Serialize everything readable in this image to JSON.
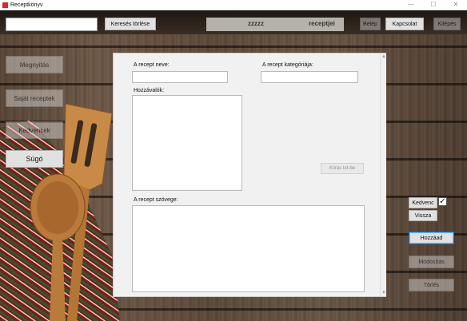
{
  "window": {
    "title": "Receptkönyv",
    "min_glyph": "—",
    "max_glyph": "☐",
    "close_glyph": "✕"
  },
  "top": {
    "search_value": "",
    "clear_search_label": "Keresés törlése",
    "info_left": "zzzzz",
    "info_right": "receptjei",
    "login_label": "Belép",
    "contact_label": "Kapcsolat",
    "logout_label": "Kilépés"
  },
  "sidebar": {
    "open_label": "Megnyitás",
    "own_recipes_label": "Saját receptek",
    "favorites_label": "Kedvencek",
    "help_label": "Súgó"
  },
  "form": {
    "name_label": "A recept neve:",
    "name_value": "",
    "category_label": "A recept kategóriája:",
    "category_value": "",
    "ingredients_label": "Hozzávalók:",
    "ingredients_value": "",
    "export_label": "Kiírás txt-be",
    "text_label": "A recept szövege:",
    "text_value": ""
  },
  "right": {
    "favorite_label": "Kedvenc",
    "favorite_checked": true,
    "favorite_mark": "✓",
    "back_label": "Vissza",
    "add_label": "Hozzáad",
    "modify_label": "Módosítás",
    "delete_label": "Törlés"
  }
}
